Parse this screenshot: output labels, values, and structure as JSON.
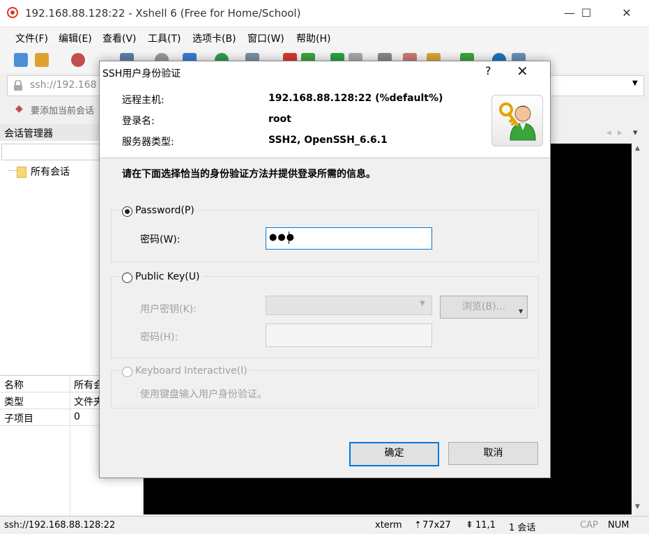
{
  "window": {
    "title": "192.168.88.128:22 - Xshell 6 (Free for Home/School)",
    "controls": {
      "minimize": "—",
      "maximize": "☐",
      "close": "✕"
    }
  },
  "menu": [
    "文件(F)",
    "编辑(E)",
    "查看(V)",
    "工具(T)",
    "选项卡(B)",
    "窗口(W)",
    "帮助(H)"
  ],
  "address_bar": {
    "text": "ssh://192.168"
  },
  "favorites_bar": {
    "text": "要添加当前会话"
  },
  "session_manager": {
    "title": "会话管理器",
    "tree_item": "所有会话"
  },
  "properties": [
    {
      "key": "名称",
      "value": "所有会"
    },
    {
      "key": "类型",
      "value": "文件夹"
    },
    {
      "key": "子项目",
      "value": "0"
    }
  ],
  "status_bar": {
    "address": "ssh://192.168.88.128:22",
    "term": "xterm",
    "size": "77x27",
    "cursor": "11,1",
    "sessions": "1 会话",
    "cap": "CAP",
    "num": "NUM"
  },
  "dialog": {
    "title": "SSH用户身份验证",
    "help": "?",
    "close": "✕",
    "remote_host_label": "远程主机:",
    "remote_host_value": "192.168.88.128:22 (%default%)",
    "login_label": "登录名:",
    "login_value": "root",
    "server_type_label": "服务器类型:",
    "server_type_value": "SSH2, OpenSSH_6.6.1",
    "instruction": "请在下面选择恰当的身份验证方法并提供登录所需的信息。",
    "password_option": "Password(P)",
    "password_label": "密码(W):",
    "password_value": "●●●",
    "public_key_option": "Public Key(U)",
    "user_key_label": "用户密钥(K):",
    "browse_button": "浏览(B)...",
    "passphrase_label": "密码(H):",
    "keyboard_option": "Keyboard Interactive(I)",
    "keyboard_desc": "使用键盘输入用户身份验证。",
    "ok_button": "确定",
    "cancel_button": "取消"
  },
  "colors": {
    "accent": "#0078d7",
    "terminal_bg": "#000000",
    "badge_green": "#3aa53a"
  }
}
